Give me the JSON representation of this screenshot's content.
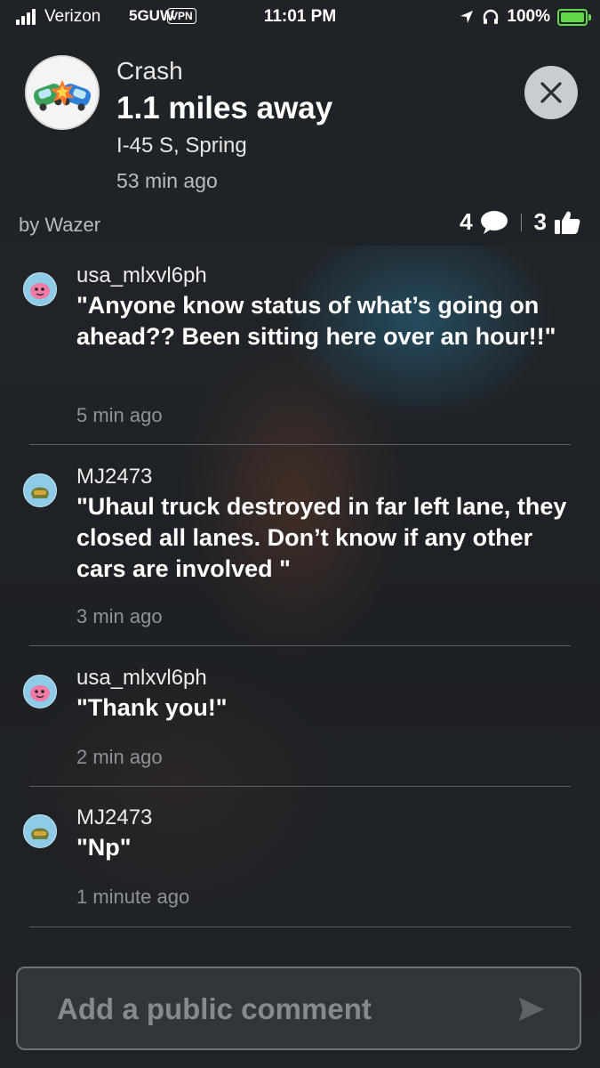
{
  "status_bar": {
    "carrier": "Verizon",
    "network": "5GUW",
    "vpn": "VPN",
    "time": "11:01 PM",
    "battery": "100%",
    "icons": [
      "signal-icon",
      "location-arrow-icon",
      "headphones-icon",
      "battery-charging-icon"
    ]
  },
  "alert": {
    "type": "Crash",
    "distance": "1.1 miles away",
    "road": "I-45 S, Spring",
    "reported": "53 min ago",
    "by": "by Wazer",
    "comment_count": "4",
    "thumbs_count": "3",
    "icon": "crash-icon"
  },
  "comments": [
    {
      "author": "usa_mlxvl6ph",
      "text": "\"Anyone know status of what’s going on ahead?? Been sitting here over an hour!!\"",
      "time": "5 min ago",
      "avatar": "pink-wazer-avatar"
    },
    {
      "author": "MJ2473",
      "text": "\"Uhaul truck destroyed in far left lane, they closed all lanes. Don’t know if any other cars are involved \"",
      "time": "3 min ago",
      "avatar": "helmet-wazer-avatar"
    },
    {
      "author": "usa_mlxvl6ph",
      "text": "\"Thank you!\"",
      "time": "2 min ago",
      "avatar": "pink-wazer-avatar"
    },
    {
      "author": "MJ2473",
      "text": "\"Np\"",
      "time": "1 minute ago",
      "avatar": "helmet-wazer-avatar"
    }
  ],
  "input": {
    "placeholder": "Add a public comment",
    "value": ""
  },
  "colors": {
    "accent_green": "#63d84a",
    "background": "#1e2328",
    "muted_text": "#8e9399"
  }
}
